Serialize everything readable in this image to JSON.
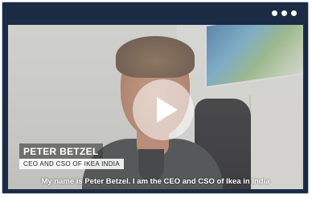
{
  "player": {
    "menu_icon": "more-horizontal-icon",
    "play_icon": "play-icon",
    "colors": {
      "frame": "#1b2b45",
      "border": "#b9c2d3"
    }
  },
  "lower_third": {
    "name": "PETER BETZEL",
    "title": "CEO AND CSO OF IKEA INDIA"
  },
  "captions": {
    "text": "My name is Peter Betzel. I am the CEO and CSO of Ikea in India"
  }
}
